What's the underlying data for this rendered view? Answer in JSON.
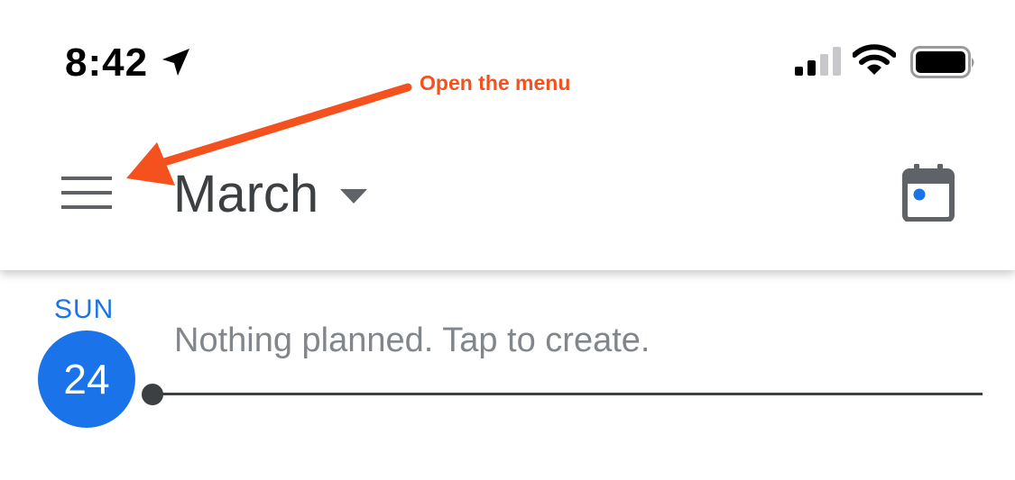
{
  "status_bar": {
    "time": "8:42",
    "icons": [
      "location-arrow-icon",
      "signal-icon",
      "wifi-icon",
      "battery-icon"
    ]
  },
  "app_bar": {
    "menu_icon": "hamburger-menu-icon",
    "month": "March",
    "month_dropdown_icon": "dropdown-triangle-icon",
    "today_icon": "calendar-today-icon"
  },
  "annotation": {
    "text": "Open the menu",
    "color": "#f4511e"
  },
  "agenda": {
    "day_of_week": "SUN",
    "day_number": "24",
    "empty_message": "Nothing planned. Tap to create."
  },
  "colors": {
    "accent": "#1a73e8",
    "text_primary": "#3c4043",
    "text_secondary": "#80868b",
    "annotation": "#f4511e"
  }
}
